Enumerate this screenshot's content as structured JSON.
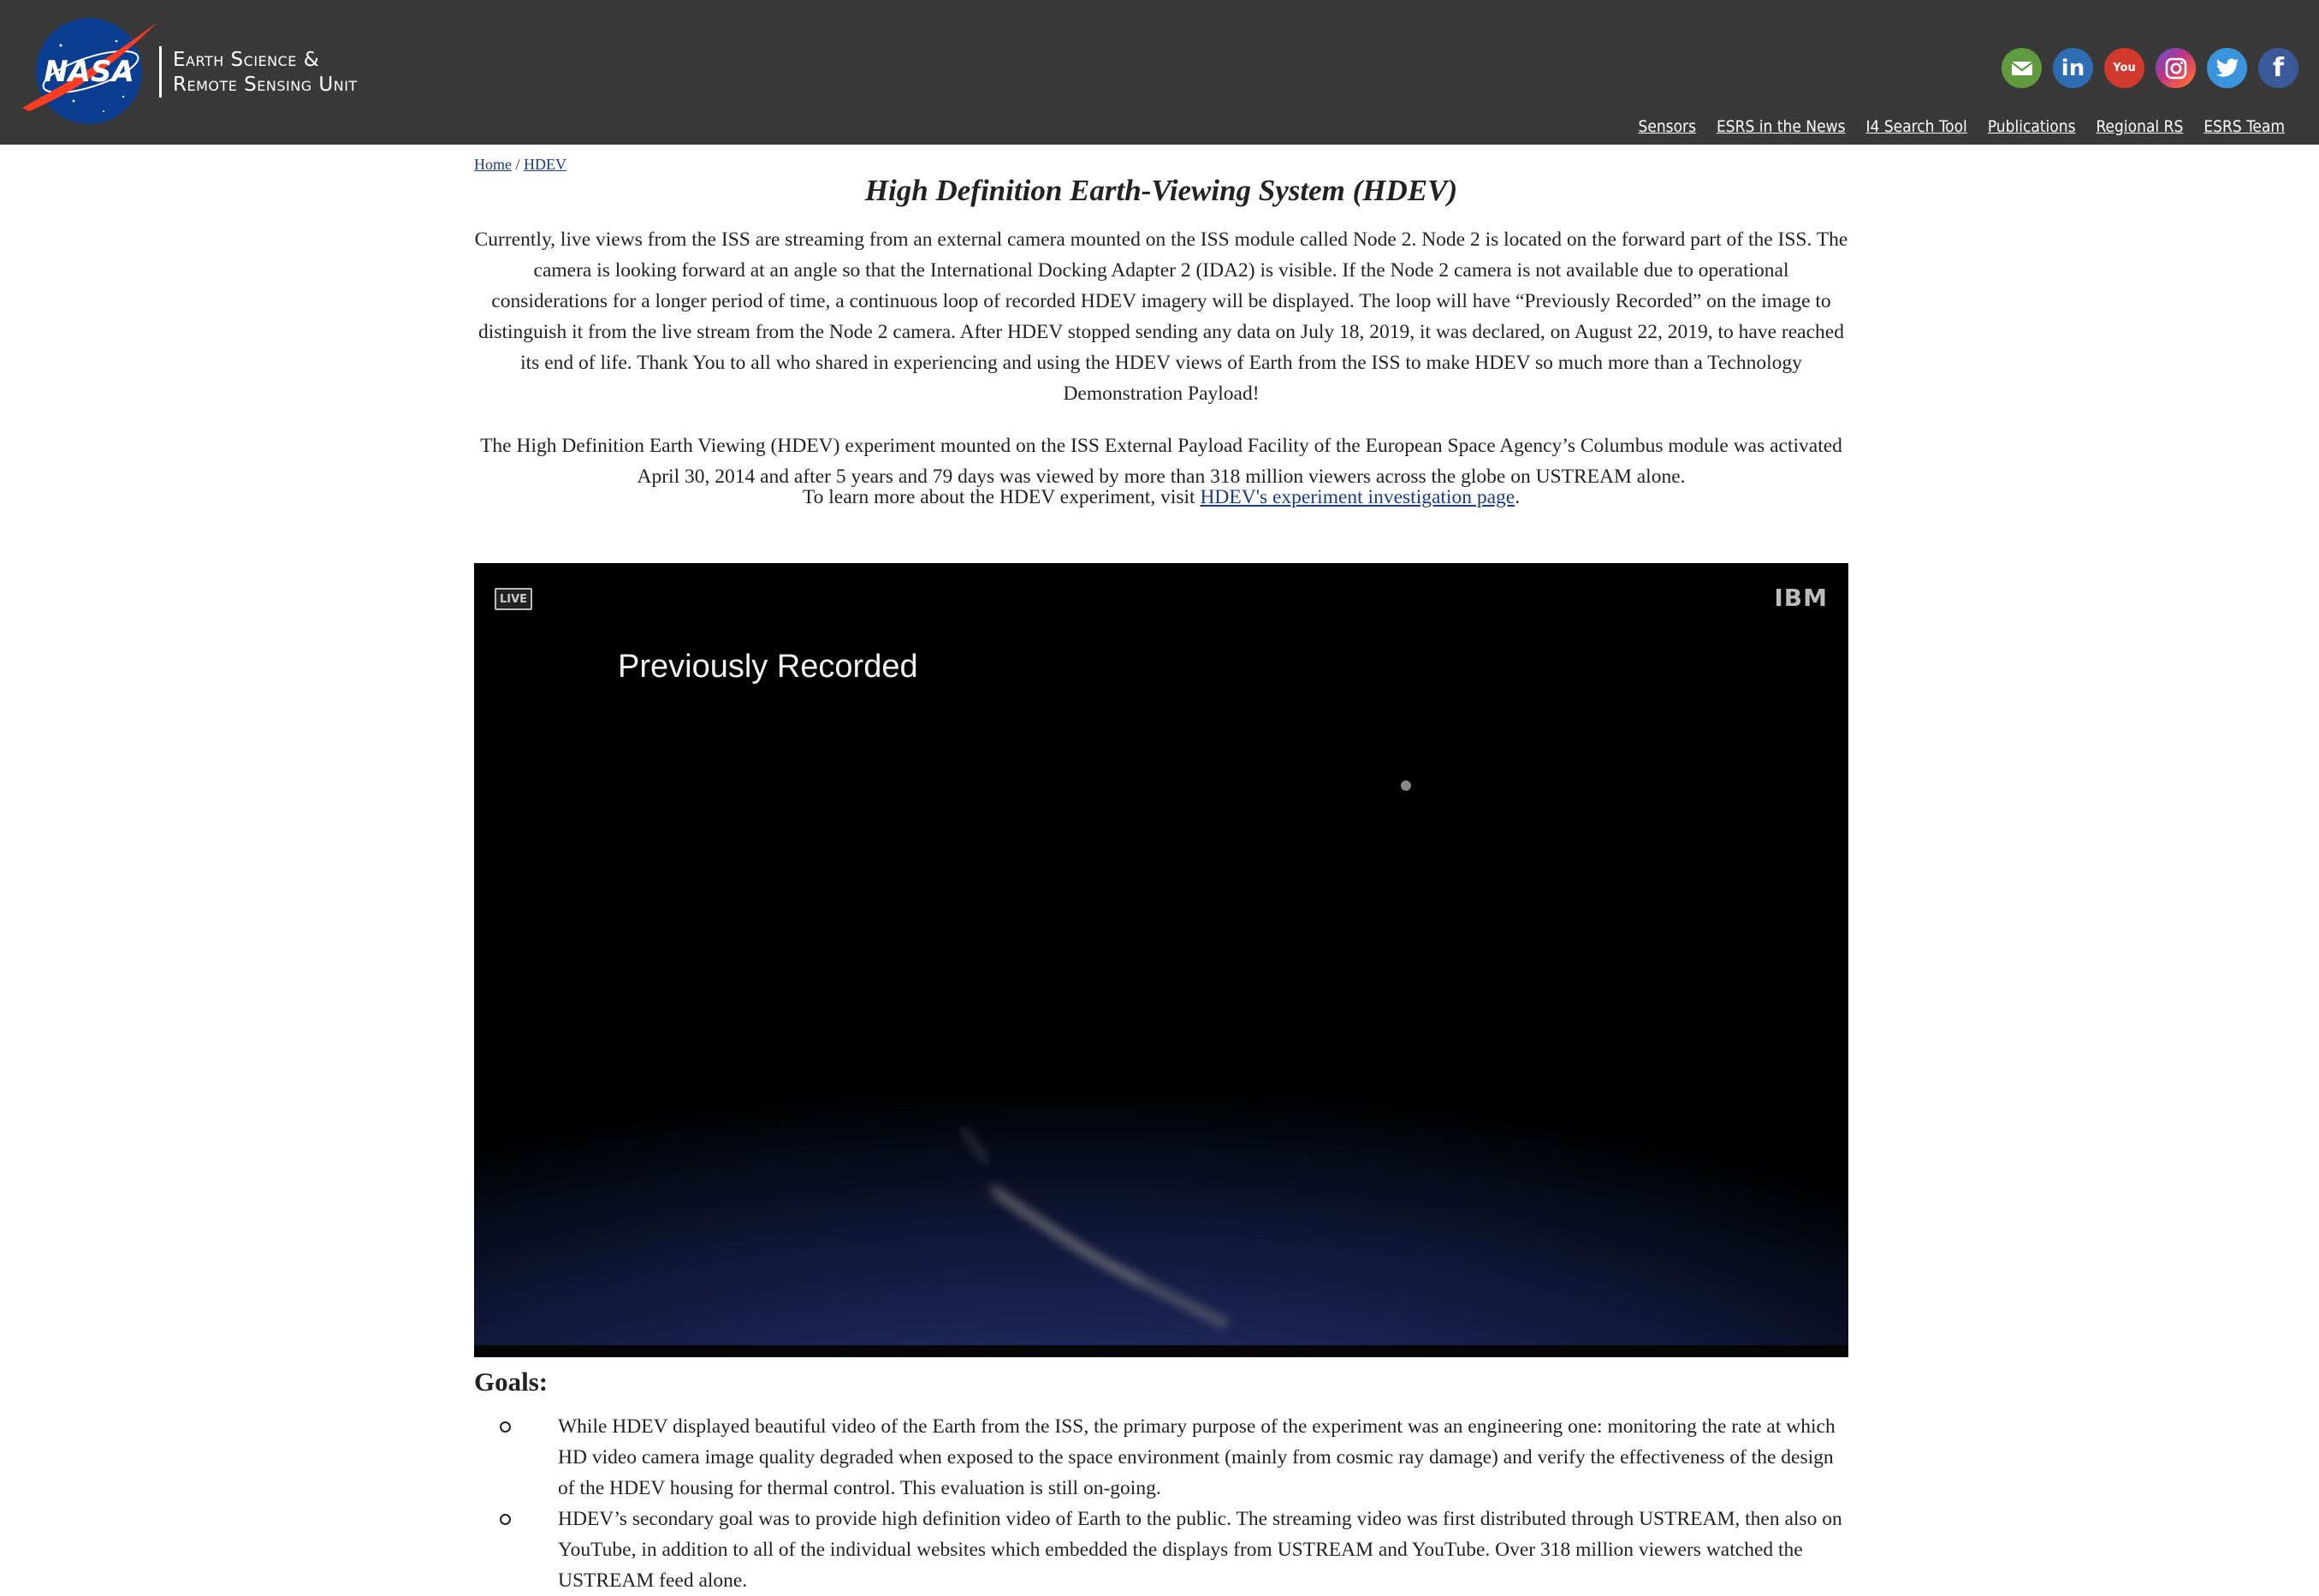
{
  "header": {
    "logo_text": "NASA",
    "unit_name_line1": "Earth Science &",
    "unit_name_line2": "Remote Sensing Unit",
    "social": [
      {
        "name": "email-icon"
      },
      {
        "name": "linkedin-icon",
        "glyph": "in"
      },
      {
        "name": "youtube-icon",
        "glyph": "You"
      },
      {
        "name": "instagram-icon"
      },
      {
        "name": "twitter-icon"
      },
      {
        "name": "facebook-icon",
        "glyph": "f"
      }
    ],
    "nav": [
      "Sensors",
      "ESRS in the News",
      "I4 Search Tool",
      "Publications",
      "Regional RS",
      "ESRS Team"
    ]
  },
  "breadcrumb": {
    "home": "Home",
    "separator": "/",
    "current": "HDEV"
  },
  "page_title": "High Definition Earth-Viewing System (HDEV)",
  "paragraphs": {
    "p1": "Currently, live views from the ISS are streaming from an external camera mounted on the ISS module called Node 2. Node 2 is located on the forward part of the ISS. The camera is looking forward at an angle so that the International Docking Adapter 2 (IDA2) is visible. If the Node 2 camera is not available due to operational considerations for a longer period of time, a continuous loop of recorded HDEV imagery will be displayed. The loop will have “Previously Recorded” on the image to distinguish it from the live stream from the Node 2 camera. After HDEV stopped sending any data on July 18, 2019, it was declared, on August 22, 2019, to have reached its end of life. Thank You to all who shared in experiencing and using the HDEV views of Earth from the ISS to make HDEV so much more than a Technology Demonstration Payload!",
    "p2": "The High Definition Earth Viewing (HDEV) experiment mounted on the ISS External Payload Facility of the European Space Agency’s Columbus module was activated April 30, 2014 and after 5 years and 79 days was viewed by more than 318 million viewers across the globe on USTREAM alone.",
    "p3_prefix": "To learn more about the HDEV experiment, visit ",
    "p3_link": "HDEV's experiment investigation page",
    "p3_suffix": "."
  },
  "video": {
    "live_badge": "LIVE",
    "brand": "IBM",
    "overlay": "Previously Recorded"
  },
  "goals": {
    "title": "Goals:",
    "items": [
      "While HDEV displayed beautiful video of the Earth from the ISS, the primary purpose of the experiment was an engineering one: monitoring the rate at which HD video camera image quality degraded when exposed to the space environment (mainly from cosmic ray damage) and verify the effectiveness of the design of the HDEV housing for thermal control. This evaluation is still on-going.",
      "HDEV’s secondary goal was to provide high definition video of Earth to the public. The streaming video was first distributed through USTREAM, then also on YouTube, in addition to all of the individual websites which embedded the displays from USTREAM and YouTube. Over 318 million viewers watched the USTREAM feed alone."
    ]
  },
  "colors": {
    "header_bg": "#393939",
    "link": "#1a3b8a",
    "nasa_blue": "#0b3d91",
    "nasa_red": "#fc3d21"
  }
}
